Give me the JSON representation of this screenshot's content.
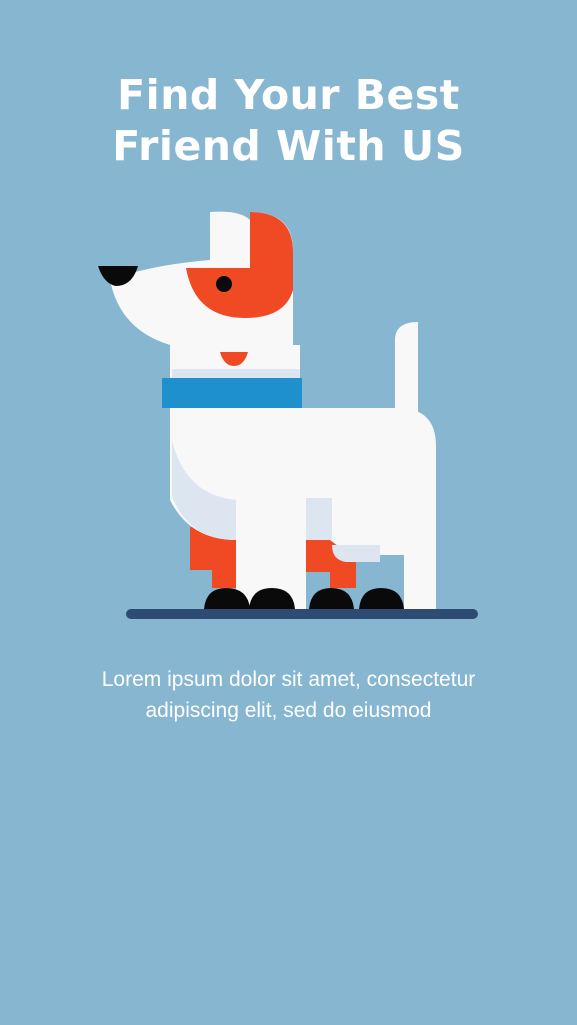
{
  "screen": {
    "background_color": "#87B6D1"
  },
  "onboarding": {
    "title_line_1": "Find Your Best",
    "title_line_2": "Friend With US",
    "description": "Lorem ipsum dolor sit amet, consectetur adipiscing elit, sed do eiusmod"
  },
  "illustration": {
    "icon": "dog-illustration-icon",
    "colors": {
      "body": "#F8F8F8",
      "shadow": "#DDE5F1",
      "spot": "#F04A24",
      "collar": "#1E90CC",
      "paws": "#0A0A0A",
      "ground": "#2E4B73"
    }
  }
}
